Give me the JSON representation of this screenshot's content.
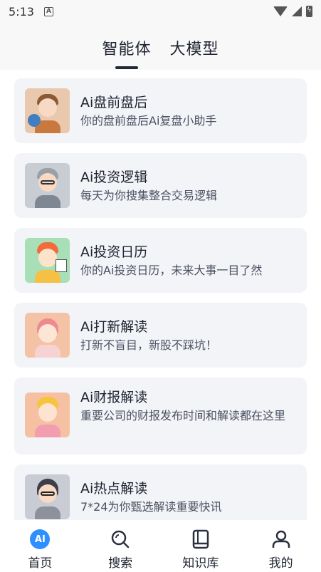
{
  "status_bar": {
    "time": "5:13",
    "notif_icon": "A"
  },
  "top_tabs": [
    {
      "label": "智能体",
      "active": true
    },
    {
      "label": "大模型",
      "active": false
    }
  ],
  "agents": [
    {
      "title": "Ai盘前盘后",
      "subtitle": "你的盘前盘后Ai复盘小助手",
      "avatar": "boy-globe-avatar"
    },
    {
      "title": "Ai投资逻辑",
      "subtitle": "每天为你搜集整合交易逻辑",
      "avatar": "old-man-glasses-avatar"
    },
    {
      "title": "Ai投资日历",
      "subtitle": "你的Ai投资日历，未来大事一目了然",
      "avatar": "girl-cap-calendar-avatar"
    },
    {
      "title": "Ai打新解读",
      "subtitle": "打新不盲目，新股不踩坑！",
      "avatar": "pink-hair-girl-avatar"
    },
    {
      "title": "Ai财报解读",
      "subtitle": "重要公司的财报发布时间和解读都在这里",
      "avatar": "yellow-hat-girl-avatar"
    },
    {
      "title": "Ai热点解读",
      "subtitle": "7*24为你甄选解读重要快讯",
      "avatar": "glasses-girl-laptop-avatar"
    }
  ],
  "bottom_nav": [
    {
      "label": "首页",
      "icon": "ai-home-icon",
      "badge": "AI"
    },
    {
      "label": "搜索",
      "icon": "search-icon"
    },
    {
      "label": "知识库",
      "icon": "book-icon"
    },
    {
      "label": "我的",
      "icon": "user-icon"
    }
  ],
  "colors": {
    "accent": "#2e8fff",
    "card_bg": "#f3f4f8",
    "header_bg": "#f8f8f9"
  }
}
